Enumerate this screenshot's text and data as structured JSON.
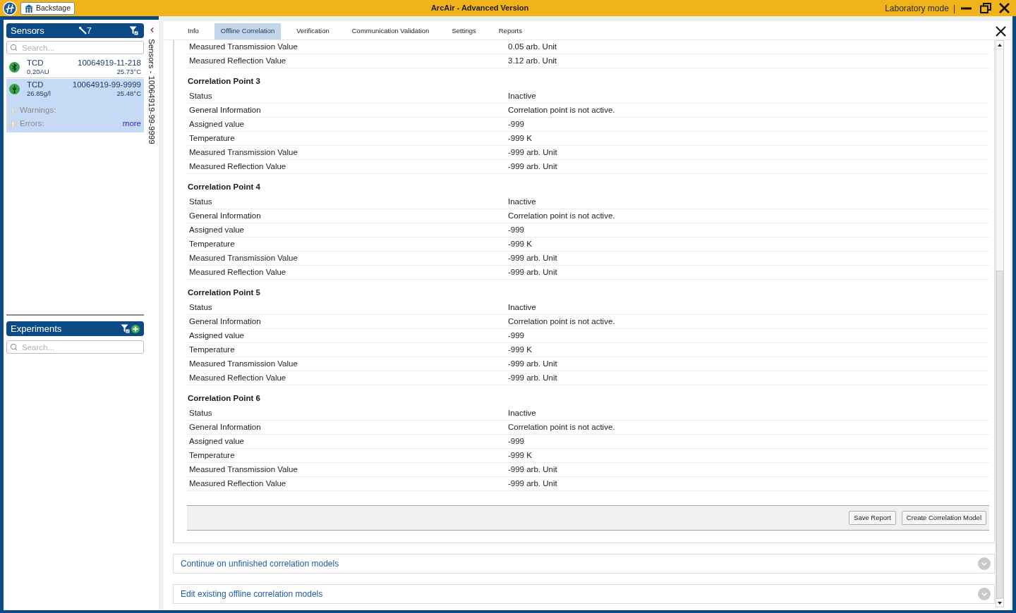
{
  "window": {
    "title": "ArcAir - Advanced Version",
    "backstage_button": "Backstage",
    "mode": "Laboratory mode",
    "mode_separator": "|"
  },
  "sidebar": {
    "sensors": {
      "title": "Sensors",
      "count": "7",
      "search_placeholder": "Search...",
      "items": [
        {
          "kind": "bluetooth",
          "name": "TCD",
          "reading": "0.20AU",
          "serial": "10064919-11-218",
          "temperature": "25.73°C",
          "selected": false
        },
        {
          "kind": "usb",
          "name": "TCD",
          "reading": "26.85g/l",
          "serial": "10064919-99-9999",
          "temperature": "25.48°C",
          "selected": true,
          "details": {
            "warnings_label": "Warnings:",
            "errors_label": "Errors:",
            "more_link": "more"
          }
        }
      ]
    },
    "experiments": {
      "title": "Experiments",
      "search_placeholder": "Search..."
    },
    "collapsed_panel_title": "Sensors - 10064919-99-9999"
  },
  "tabs": [
    {
      "label": "Info",
      "selected": false
    },
    {
      "label": "Offline Correlation",
      "selected": true
    },
    {
      "label": "Verification",
      "selected": false
    },
    {
      "label": "Communication Validation",
      "selected": false
    },
    {
      "label": "Settings",
      "selected": false
    },
    {
      "label": "Reports",
      "selected": false
    }
  ],
  "correlation_points": [
    {
      "rows": [
        {
          "label": "Measured Transmission Value",
          "value": "0.05 arb. Unit"
        },
        {
          "label": "Measured Reflection Value",
          "value": "3.12 arb. Unit"
        }
      ]
    },
    {
      "title": "Correlation Point 3",
      "rows": [
        {
          "label": "Status",
          "value": "Inactive"
        },
        {
          "label": "General Information",
          "value": "Correlation point is not active."
        },
        {
          "label": "Assigned value",
          "value": "-999"
        },
        {
          "label": "Temperature",
          "value": "-999 K"
        },
        {
          "label": "Measured Transmission Value",
          "value": "-999 arb. Unit"
        },
        {
          "label": "Measured Reflection Value",
          "value": "-999 arb. Unit"
        }
      ]
    },
    {
      "title": "Correlation Point 4",
      "rows": [
        {
          "label": "Status",
          "value": "Inactive"
        },
        {
          "label": "General Information",
          "value": "Correlation point is not active."
        },
        {
          "label": "Assigned value",
          "value": "-999"
        },
        {
          "label": "Temperature",
          "value": "-999 K"
        },
        {
          "label": "Measured Transmission Value",
          "value": "-999 arb. Unit"
        },
        {
          "label": "Measured Reflection Value",
          "value": "-999 arb. Unit"
        }
      ]
    },
    {
      "title": "Correlation Point 5",
      "rows": [
        {
          "label": "Status",
          "value": "Inactive"
        },
        {
          "label": "General Information",
          "value": "Correlation point is not active."
        },
        {
          "label": "Assigned value",
          "value": "-999"
        },
        {
          "label": "Temperature",
          "value": "-999 K"
        },
        {
          "label": "Measured Transmission Value",
          "value": "-999 arb. Unit"
        },
        {
          "label": "Measured Reflection Value",
          "value": "-999 arb. Unit"
        }
      ]
    },
    {
      "title": "Correlation Point 6",
      "rows": [
        {
          "label": "Status",
          "value": "Inactive"
        },
        {
          "label": "General Information",
          "value": "Correlation point is not active."
        },
        {
          "label": "Assigned value",
          "value": "-999"
        },
        {
          "label": "Temperature",
          "value": "-999 K"
        },
        {
          "label": "Measured Transmission Value",
          "value": "-999 arb. Unit"
        },
        {
          "label": "Measured Reflection Value",
          "value": "-999 arb. Unit"
        }
      ]
    }
  ],
  "footer_buttons": [
    "Save Report",
    "Create Correlation Model"
  ],
  "accordions": [
    {
      "title": "Continue on unfinished correlation models",
      "expanded": false
    },
    {
      "title": "Edit existing offline correlation models",
      "expanded": false
    }
  ]
}
